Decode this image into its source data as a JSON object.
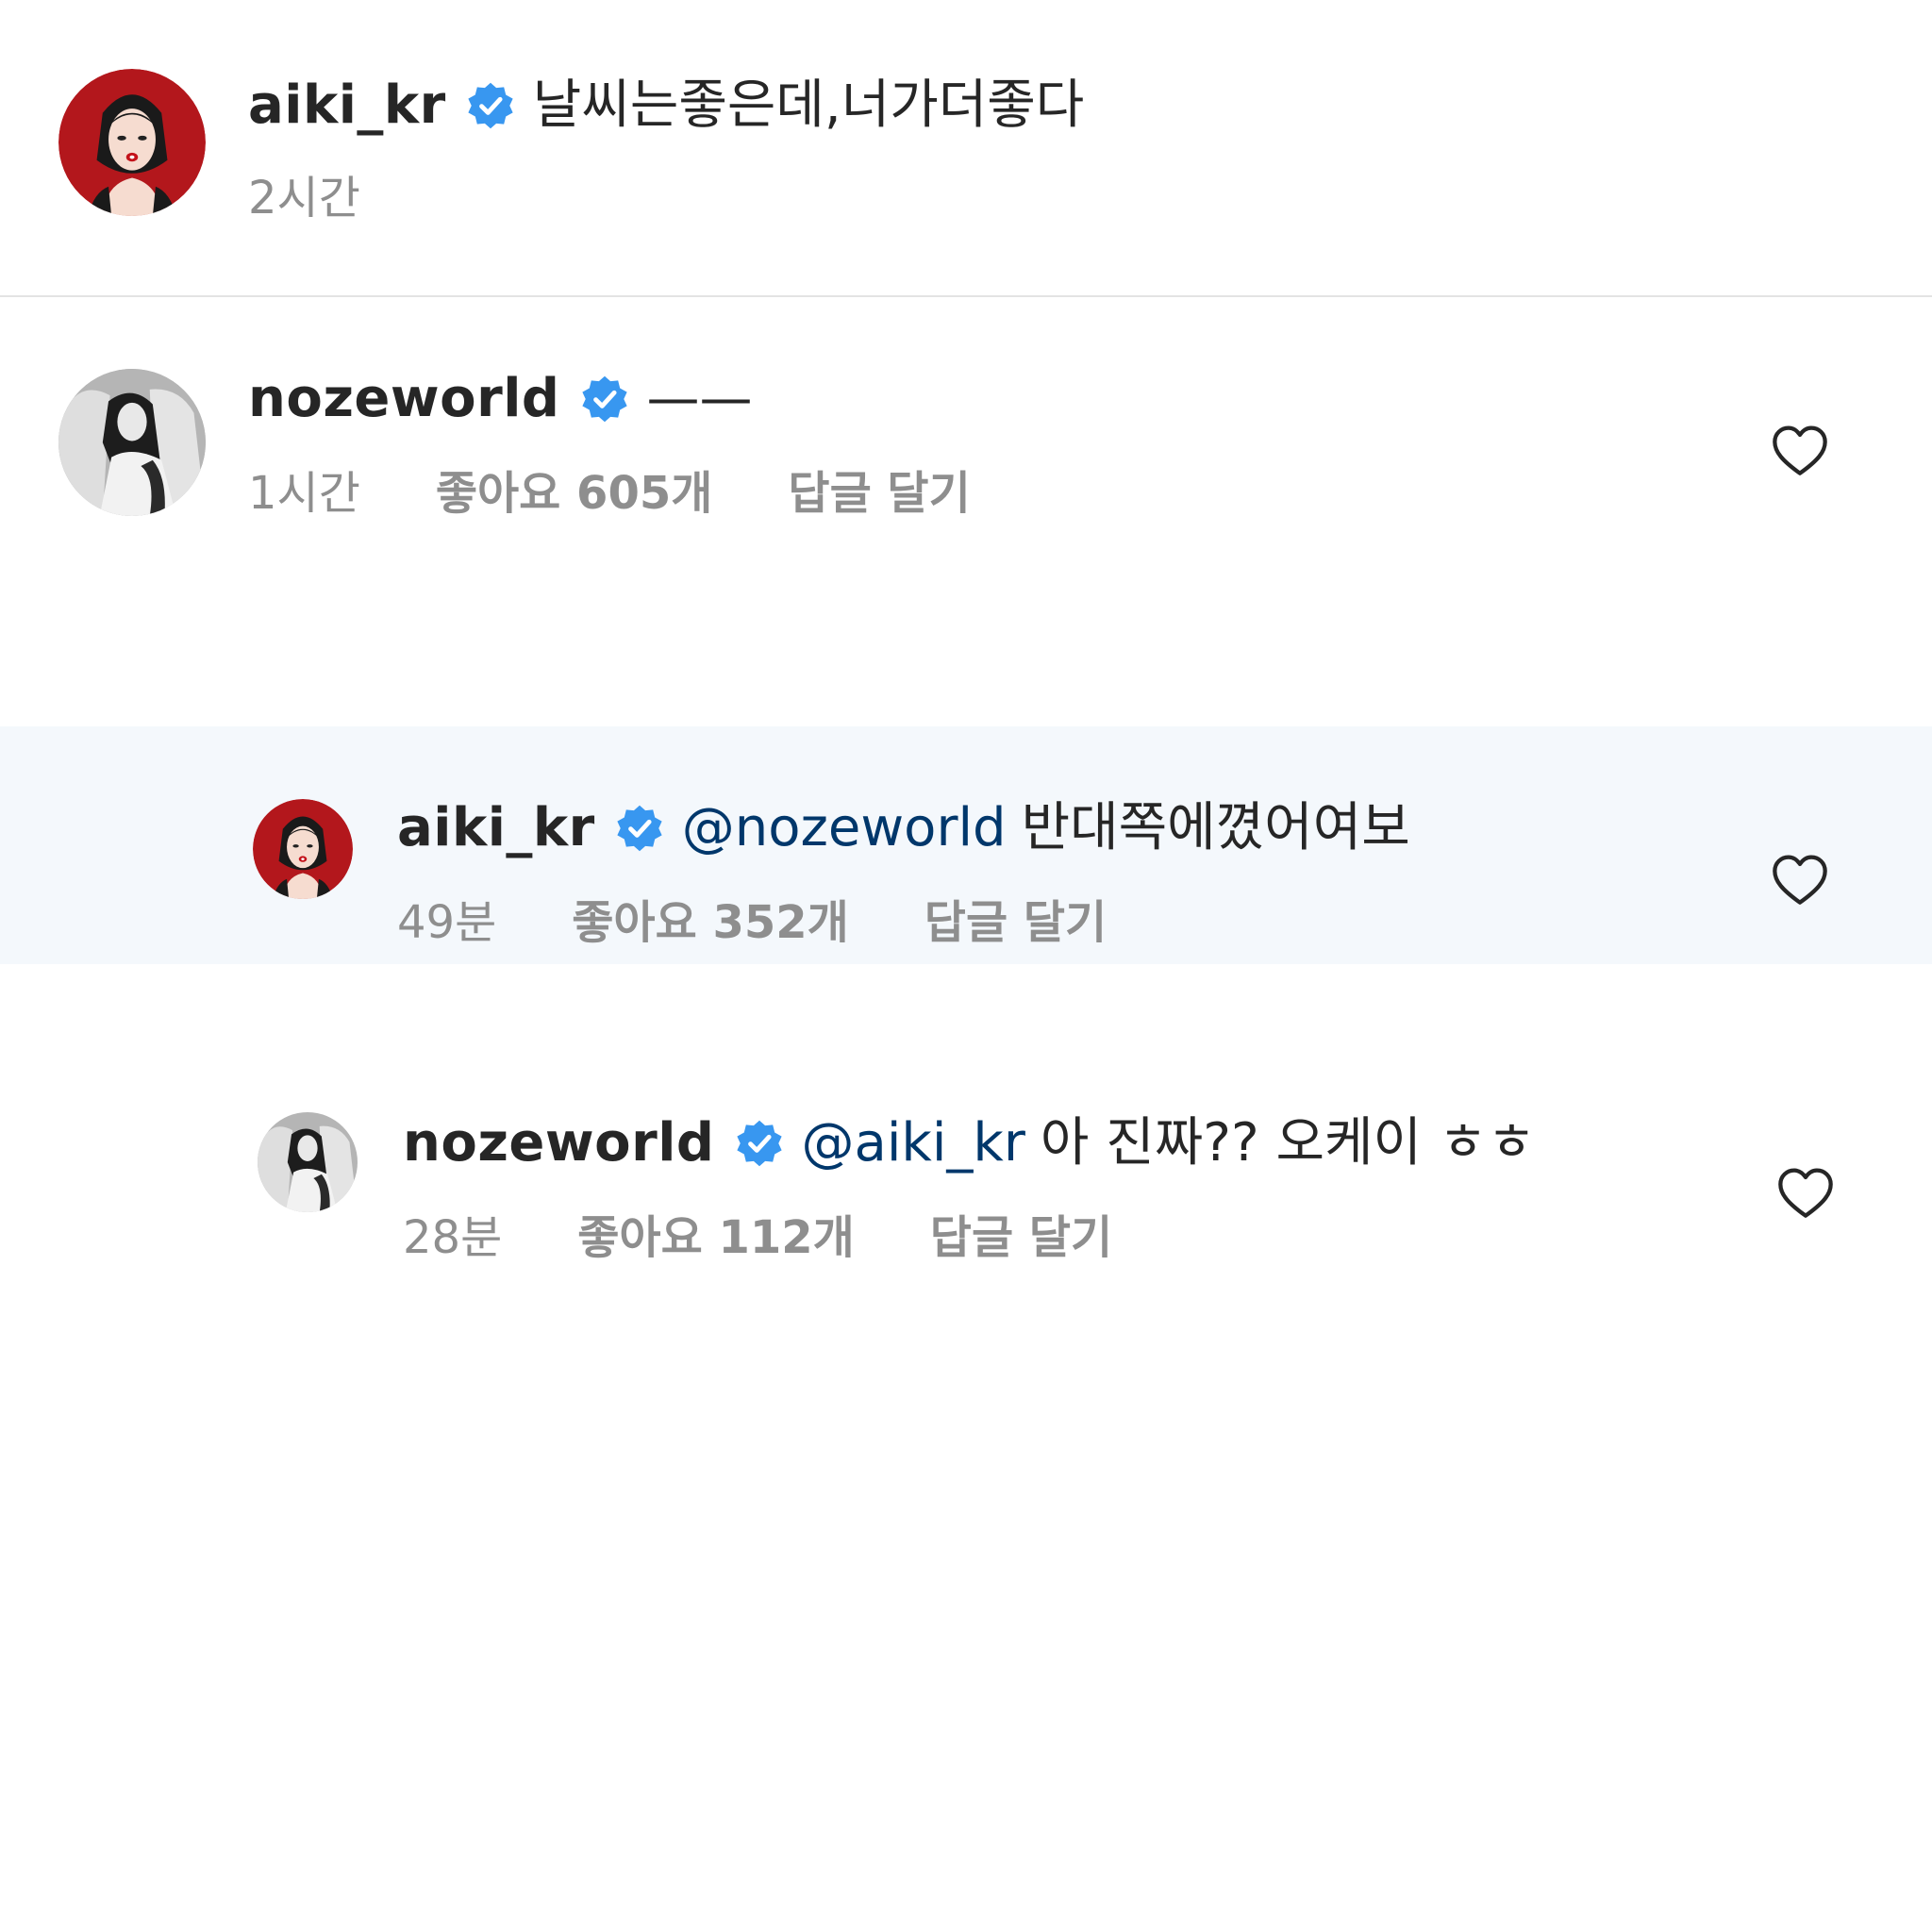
{
  "caption": {
    "username": "aiki_kr",
    "text": "날씨는좋은데,너가더좋다",
    "time": "2시간"
  },
  "comments": [
    {
      "username": "nozeworld",
      "mention": "",
      "text": "——",
      "time": "1시간",
      "likes": "좋아요 605개",
      "reply": "답글 달기"
    },
    {
      "username": "aiki_kr",
      "mention": "@nozeworld",
      "text": "반대쪽에꼈어여보",
      "time": "49분",
      "likes": "좋아요 352개",
      "reply": "답글 달기"
    },
    {
      "username": "nozeworld",
      "mention": "@aiki_kr",
      "text": "아 진짜?? 오케이 ㅎㅎ",
      "time": "28분",
      "likes": "좋아요 112개",
      "reply": "답글 달기"
    }
  ],
  "icons": {
    "verified": "verified-badge-icon",
    "like": "heart-icon"
  },
  "colors": {
    "verified_blue": "#3897f0",
    "mention": "#00376b",
    "meta_gray": "#8e8e8e",
    "highlight_bg": "#f4f8fc"
  }
}
